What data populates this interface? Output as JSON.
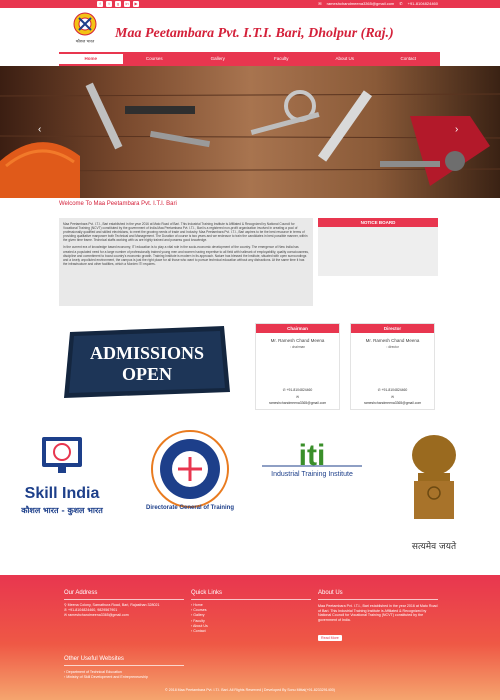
{
  "topbar": {
    "email": "rameshchandmeena3365@gmail.com",
    "phone": "+91-8104824460",
    "social_icons": [
      "facebook-icon",
      "twitter-icon",
      "google-plus-icon",
      "linkedin-icon",
      "youtube-icon"
    ]
  },
  "header": {
    "title": "Maa Peetambara Pvt. I.T.I. Bari, Dholpur (Raj.)",
    "logo_caption": "कौशल भारत"
  },
  "nav": {
    "items": [
      "Home",
      "Courses",
      "Gallery",
      "Faculty",
      "About Us",
      "Contact"
    ],
    "active": "Home"
  },
  "welcome": {
    "heading": "Welcome To Maa Peetambara Pvt. I.T.I. Bari",
    "para1": "Maa Peetambara Pvt. I.T.I., Bari established in the year 2016 at Mato Road of Bari. This Industrial Training Institute is Affiliated & Recognized by National Council for Vocational Training (NCVT) constituted by the government of India.Maa Peetambara Pvt. I.T.I., Bari is a registered non-profit organization involved in creating a pool of professionally qualified and skilled electricians, to meet the growing needs of trade and Industry. Maa Peetambara Pvt. I.T.I., Bari aspires to be the best resource in terms of providing qualitative manpower both Technical and Management. The Duration of course is two years and we endeavor to train the candidates in best possible manner, within the given time frame. Technical staffs working with us are highly trained and possess good knowledge.",
    "para2": "In the current era of knowledge based economy, ITI education is to play a vital role in the socio-economic development of the country. The emergence of New India has created a populated need for a large number of professionally trained young men and women having expertise to all field with hallmark of employability, quality consciousness, discipline and commitment to boost country's economic growth. Training Institute is modern in its approach. Nature has blessed the Institute, situated with open surroundings and a lovely unpolluted environment, the campus is just the right place for all those who want to pursue technical education without any distractions. At the same time it has the infrastructure and other facilities, which a Morden ITI requires."
  },
  "notice": {
    "title": "NOTICE BOARD"
  },
  "admission": {
    "line1": "ADMISSIONS",
    "line2": "OPEN"
  },
  "chairman": {
    "title": "Chairman",
    "name": "Mr. Ramesh Chand Meena",
    "img_alt": "chairman",
    "phone": "+91-8104824460",
    "email": "rameshchandmeena3365@gmail.com"
  },
  "director": {
    "title": "Director",
    "name": "Mr. Ramesh Chand Meena",
    "img_alt": "director",
    "phone": "+91-8104824460",
    "email": "rameshchandmeena3365@gmail.com"
  },
  "logos": {
    "skill_india": "Skill India",
    "skill_india_hindi": "कौशल भारत - कुशल भारत",
    "dgt": "Directorate General of Training",
    "iti_mark": "iti",
    "iti": "Industrial Training Institute",
    "satyameva": "सत्यमेव जयते"
  },
  "footer": {
    "address_title": "Our Address",
    "address_line1": "Meena Colony, Sarnathura Road, Bari, Rajasthan 328021",
    "address_phone": "+91-8104824460, 9829567901",
    "address_email": "rameshchandmeena3365@gmail.com",
    "quick_title": "Quick Links",
    "quick_links": [
      "Home",
      "Courses",
      "Gallery",
      "Faculty",
      "About Us",
      "Contact"
    ],
    "about_title": "About Us",
    "about_text": "Maa Peetambara Pvt. I.T.I., Bari established in the year 2016 at Mato Road of Bari. This Industrial Training Institute is Affiliated & Recognized by National Council for Vocational Training (NCVT) constituted by the government of India.",
    "read_more": "Read More",
    "useful_title": "Other Useful Websites",
    "useful_links": [
      "Department of Technical Education",
      "Ministry of Skill Development and Entrepreneurship"
    ],
    "copyright": "© 2018 Maa Peetambara Pvt. I.T.I. Bari. All Rights Reserved | Developed By Sonu Mittal(+91-8233291400)"
  }
}
